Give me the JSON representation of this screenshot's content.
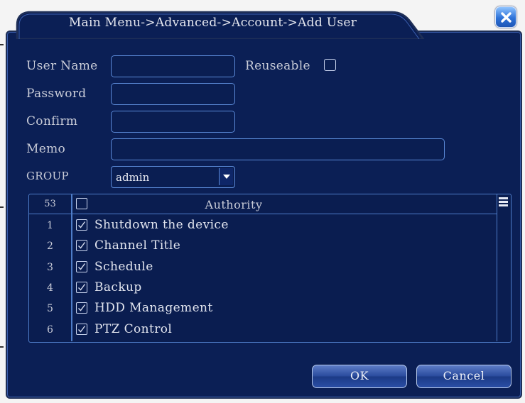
{
  "window": {
    "title": "Main Menu->Advanced->Account->Add User"
  },
  "form": {
    "username": {
      "label": "User Name",
      "value": ""
    },
    "reuseable": {
      "label": "Reuseable",
      "checked": false
    },
    "password": {
      "label": "Password",
      "value": ""
    },
    "confirm": {
      "label": "Confirm",
      "value": ""
    },
    "memo": {
      "label": "Memo",
      "value": ""
    },
    "group": {
      "label": "GROUP",
      "value": "admin"
    }
  },
  "authority_table": {
    "count": "53",
    "header": "Authority",
    "rows": [
      {
        "num": "1",
        "label": "Shutdown the device",
        "checked": true
      },
      {
        "num": "2",
        "label": "Channel Title",
        "checked": true
      },
      {
        "num": "3",
        "label": "Schedule",
        "checked": true
      },
      {
        "num": "4",
        "label": "Backup",
        "checked": true
      },
      {
        "num": "5",
        "label": "HDD Management",
        "checked": true
      },
      {
        "num": "6",
        "label": "PTZ Control",
        "checked": true
      }
    ]
  },
  "buttons": {
    "ok": "OK",
    "cancel": "Cancel"
  },
  "icons": {
    "close": "close-icon",
    "dropdown": "chevron-down-icon",
    "list_menu": "menu-icon",
    "check": "check-icon"
  },
  "colors": {
    "panel_bg": "#0b1f55",
    "border_accent": "#5b8ad8",
    "close_button": "#2d72d8"
  }
}
